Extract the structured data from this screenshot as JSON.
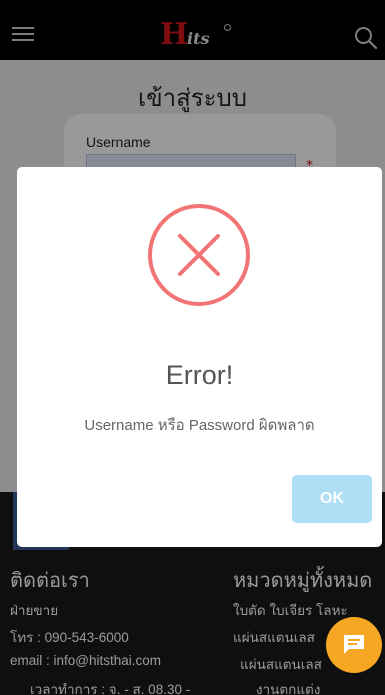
{
  "header": {
    "logo_mark": "H",
    "logo_text": "its"
  },
  "page": {
    "title": "เข้าสู่ระบบ",
    "username_label": "Username",
    "required_mark": "*"
  },
  "footer": {
    "contact_heading": "ติดต่อเรา",
    "category_heading": "หมวดหมู่ทั้งหมด",
    "contact_lines": [
      "ฝ่ายขาย",
      "โทร : 090-543-6000",
      "email : info@hitsthai.com",
      "เวลาทำการ : จ. - ส. 08.30 -"
    ],
    "category_lines": [
      "ใบตัด ใบเจียร โลหะ",
      "แผ่นสแตนเลส",
      "แผ่นสแตนเลส",
      "งานตกแต่ง"
    ]
  },
  "modal": {
    "title": "Error!",
    "message": "Username หรือ Password ผิดพลาด",
    "ok_label": "OK"
  },
  "colors": {
    "header_bg": "#000000",
    "error_red": "#f27474",
    "ok_button": "#aedff5",
    "chat_button": "#f5a623",
    "brand_red": "#d7151b"
  }
}
